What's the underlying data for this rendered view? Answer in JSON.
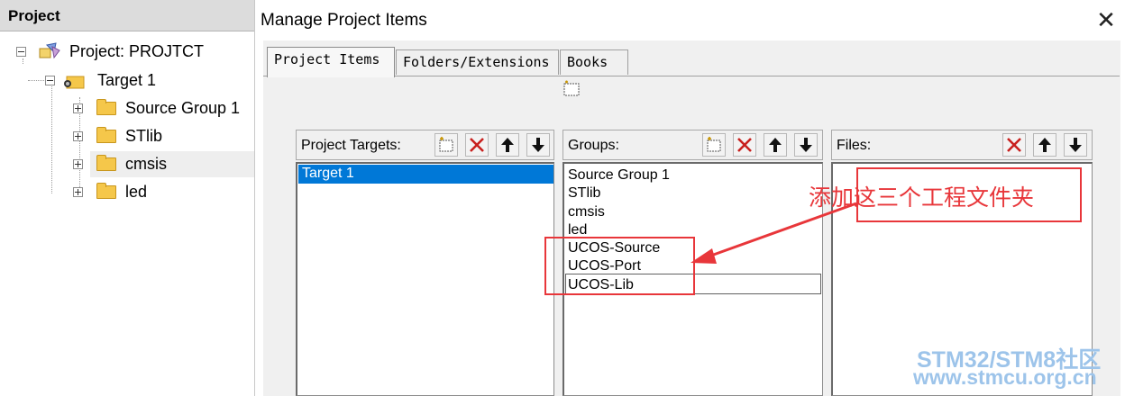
{
  "left_pane": {
    "title": "Project",
    "project_label": "Project: PROJTCT",
    "target_label": "Target 1",
    "groups": [
      "Source Group 1",
      "STlib",
      "cmsis",
      "led"
    ]
  },
  "dialog": {
    "title": "Manage Project Items",
    "close_glyph": "✕",
    "tabs": [
      "Project Items",
      "Folders/Extensions",
      "Books"
    ],
    "targets": {
      "header": "Project Targets:",
      "items": [
        "Target 1"
      ]
    },
    "groups": {
      "header": "Groups:",
      "items": [
        "Source Group 1",
        "STlib",
        "cmsis",
        "led",
        "UCOS-Source",
        "UCOS-Port",
        "UCOS-Lib"
      ]
    },
    "files": {
      "header": "Files:",
      "items": []
    }
  },
  "annotation": {
    "text": "添加这三个工程文件夹",
    "color": "#e8363a"
  },
  "watermark": {
    "line1": "STM32/STM8社区",
    "line2": "www.stmcu.org.cn"
  },
  "colors": {
    "selection": "#0078d7",
    "folder": "#f5c74a"
  }
}
